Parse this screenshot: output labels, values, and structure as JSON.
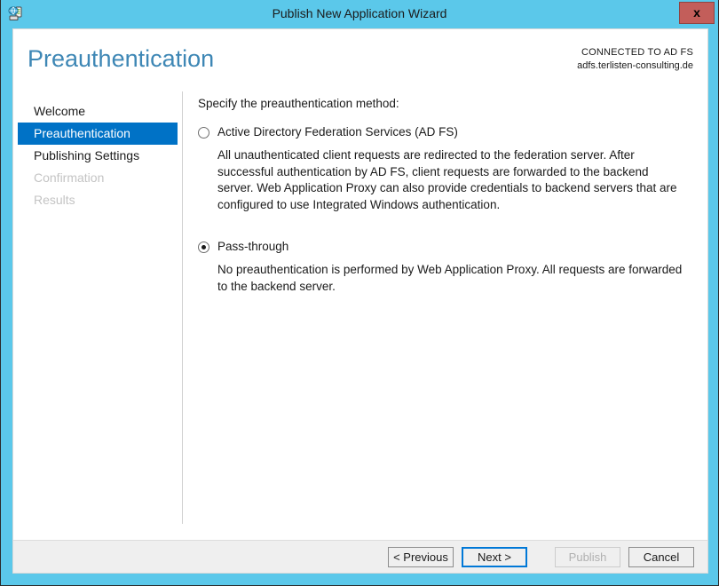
{
  "window": {
    "title": "Publish New Application Wizard",
    "icon": "application-network-icon",
    "close_label": "x",
    "chrome_color": "#5BC8EA",
    "close_color": "#c35e5a"
  },
  "header": {
    "page_title": "Preauthentication",
    "page_title_color": "#3E87B5",
    "connected_label": "CONNECTED TO AD FS",
    "connected_value": "adfs.terlisten-consulting.de"
  },
  "sidebar": {
    "accent_color": "#0072C6",
    "items": [
      {
        "label": "Welcome",
        "state": "enabled"
      },
      {
        "label": "Preauthentication",
        "state": "active"
      },
      {
        "label": "Publishing Settings",
        "state": "enabled"
      },
      {
        "label": "Confirmation",
        "state": "disabled"
      },
      {
        "label": "Results",
        "state": "disabled"
      }
    ]
  },
  "main": {
    "instruction": "Specify the preauthentication method:",
    "options": [
      {
        "label": "Active Directory Federation Services (AD FS)",
        "selected": false,
        "description": "All unauthenticated client requests are redirected to the federation server. After successful authentication by AD FS, client requests are forwarded to the backend server. Web Application Proxy can also provide credentials to backend servers that are configured to use Integrated Windows authentication."
      },
      {
        "label": "Pass-through",
        "selected": true,
        "description": "No preauthentication is performed by Web Application Proxy. All requests are forwarded to the backend server."
      }
    ]
  },
  "footer": {
    "previous_label": "< Previous",
    "next_label": "Next >",
    "publish_label": "Publish",
    "cancel_label": "Cancel",
    "focus_color": "#0078d7"
  }
}
